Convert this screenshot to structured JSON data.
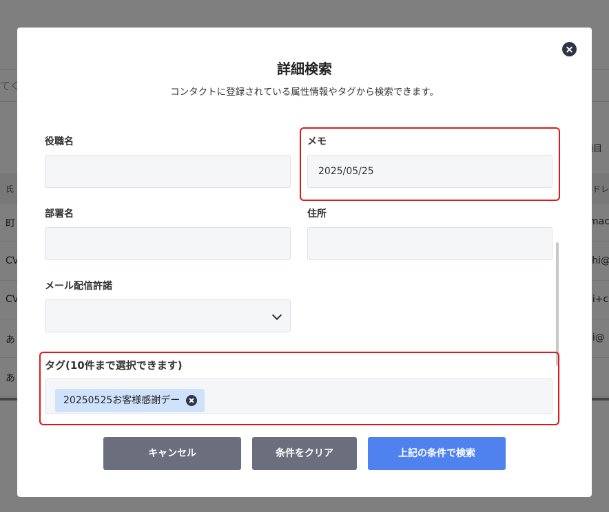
{
  "background": {
    "search_fragment": "てく",
    "items_fragment": "項目",
    "header_cells": [
      "氏",
      "アドレ"
    ],
    "rows": [
      {
        "left": "町",
        "right": "mac"
      },
      {
        "left": "CV",
        "right": "shi@"
      },
      {
        "left": "CV",
        "right": "ii+c"
      },
      {
        "left": "あ",
        "right": "ii@"
      },
      {
        "left": "あ",
        "right": ""
      }
    ]
  },
  "modal": {
    "title": "詳細検索",
    "subtitle": "コンタクトに登録されている属性情報やタグから検索できます。",
    "fields": {
      "job_title": {
        "label": "役職名",
        "value": ""
      },
      "memo": {
        "label": "メモ",
        "value": "2025/05/25"
      },
      "department": {
        "label": "部署名",
        "value": ""
      },
      "address": {
        "label": "住所",
        "value": ""
      },
      "mail_permission": {
        "label": "メール配信許諾",
        "value": ""
      }
    },
    "tags": {
      "label": "タグ(10件まで選択できます)",
      "selected": [
        "20250525お客様感謝デー"
      ]
    },
    "buttons": {
      "cancel": "キャンセル",
      "clear": "条件をクリア",
      "search": "上記の条件で検索"
    }
  },
  "colors": {
    "primary": "#4f82ee",
    "secondary": "#6b6f7d",
    "highlight": "#e0161d",
    "tag_chip": "#cfe2fb"
  }
}
